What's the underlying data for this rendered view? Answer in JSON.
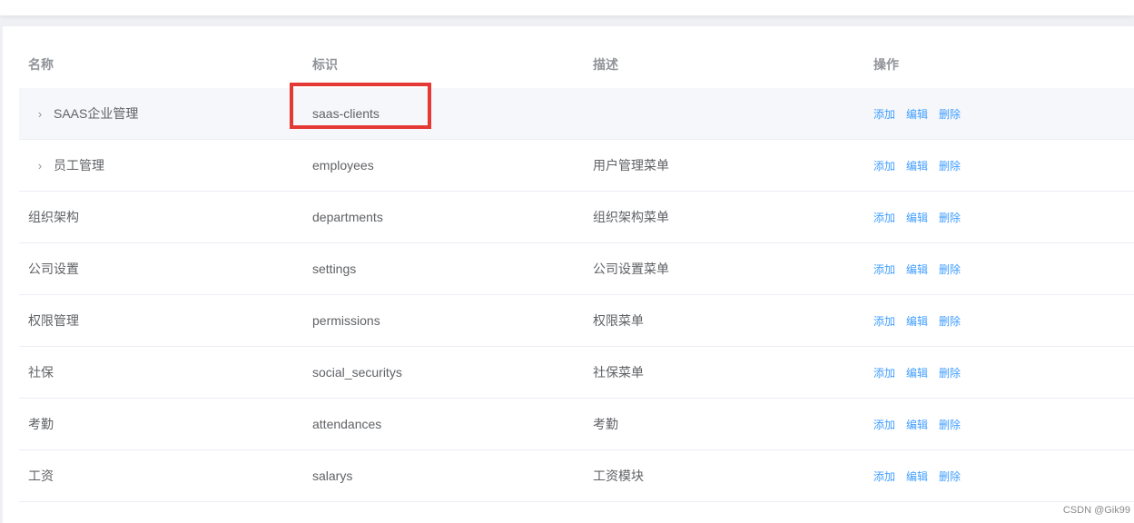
{
  "table": {
    "headers": {
      "name": "名称",
      "code": "标识",
      "desc": "描述",
      "ops": "操作"
    },
    "rows": [
      {
        "name": "SAAS企业管理",
        "code": "saas-clients",
        "desc": "",
        "expandable": true
      },
      {
        "name": "员工管理",
        "code": "employees",
        "desc": "用户管理菜单",
        "expandable": true
      },
      {
        "name": "组织架构",
        "code": "departments",
        "desc": "组织架构菜单",
        "expandable": false
      },
      {
        "name": "公司设置",
        "code": "settings",
        "desc": "公司设置菜单",
        "expandable": false
      },
      {
        "name": "权限管理",
        "code": "permissions",
        "desc": "权限菜单",
        "expandable": false
      },
      {
        "name": "社保",
        "code": "social_securitys",
        "desc": "社保菜单",
        "expandable": false
      },
      {
        "name": "考勤",
        "code": "attendances",
        "desc": "考勤",
        "expandable": false
      },
      {
        "name": "工资",
        "code": "salarys",
        "desc": "工资模块",
        "expandable": false
      }
    ],
    "actions": {
      "add": "添加",
      "edit": "编辑",
      "delete": "删除"
    },
    "expand_icon": "chevron-right-icon"
  },
  "watermark": "CSDN @Gik99",
  "colors": {
    "link": "#409eff",
    "highlight_box": "#e53935",
    "row_hover": "#f5f7fa"
  }
}
